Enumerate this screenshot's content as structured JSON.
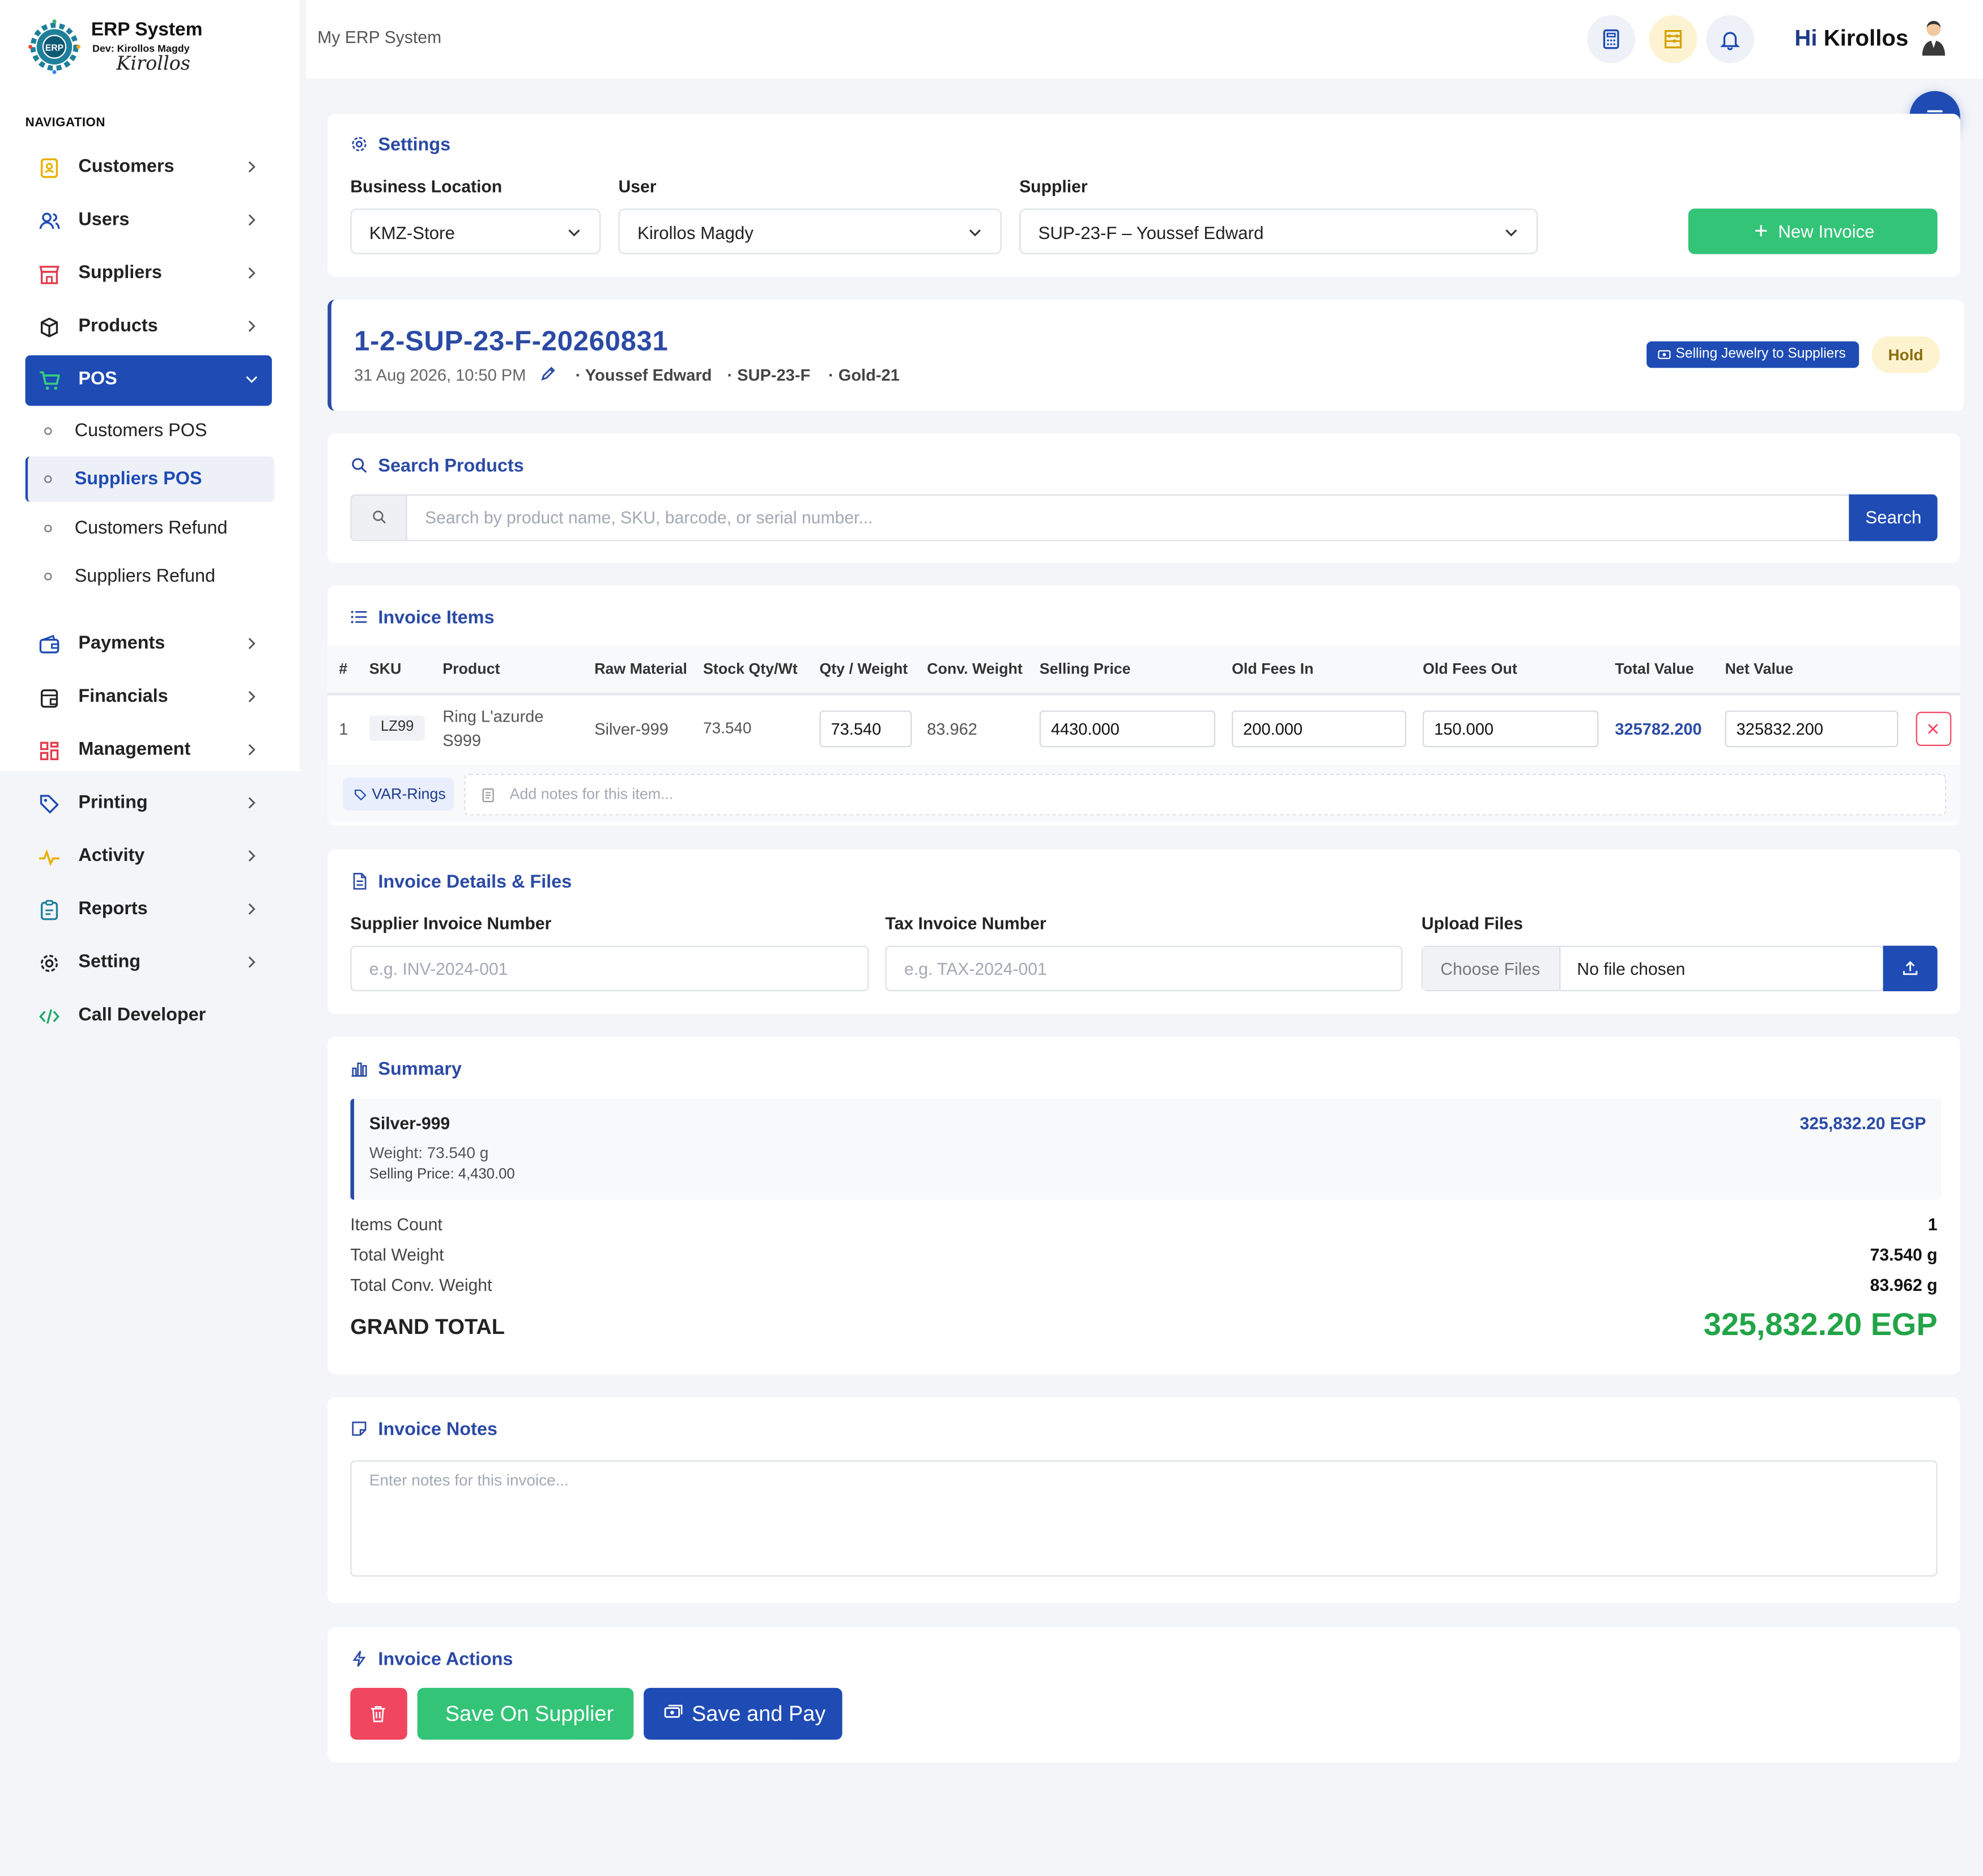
{
  "brand": {
    "title": "ERP System",
    "dev": "Dev: Kirollos Magdy",
    "signature": "Kirollos"
  },
  "nav": {
    "heading": "NAVIGATION",
    "items": [
      {
        "label": "Customers",
        "icon": "address-book-icon"
      },
      {
        "label": "Users",
        "icon": "users-icon"
      },
      {
        "label": "Suppliers",
        "icon": "store-icon"
      },
      {
        "label": "Products",
        "icon": "box-icon"
      },
      {
        "label": "POS",
        "icon": "cart-icon"
      },
      {
        "label": "Payments",
        "icon": "wallet-icon"
      },
      {
        "label": "Financials",
        "icon": "finance-icon"
      },
      {
        "label": "Management",
        "icon": "grid-icon"
      },
      {
        "label": "Printing",
        "icon": "tag-icon"
      },
      {
        "label": "Activity",
        "icon": "activity-icon"
      },
      {
        "label": "Reports",
        "icon": "clipboard-icon"
      },
      {
        "label": "Setting",
        "icon": "gear-icon"
      },
      {
        "label": "Call Developer",
        "icon": "code-icon"
      }
    ],
    "pos_sub": [
      "Customers POS",
      "Suppliers POS",
      "Customers Refund",
      "Suppliers Refund"
    ]
  },
  "topbar": {
    "title": "My ERP System",
    "greeting": "Hi",
    "user": "Kirollos"
  },
  "settings": {
    "title": "Settings",
    "location_label": "Business Location",
    "location_value": "KMZ-Store",
    "user_label": "User",
    "user_value": "Kirollos Magdy",
    "supplier_label": "Supplier",
    "supplier_value": "SUP-23-F – Youssef Edward",
    "new_invoice": "New Invoice"
  },
  "invoice": {
    "number": "1-2-SUP-23-F-20260831",
    "datetime": "31 Aug 2026, 10:50 PM",
    "supplier_name": "· Youssef Edward",
    "supplier_code": "· SUP-23-F",
    "material": "· Gold-21",
    "type_badge": "Selling Jewelry to Suppliers",
    "status": "Hold"
  },
  "search": {
    "title": "Search Products",
    "placeholder": "Search by product name, SKU, barcode, or serial number...",
    "button": "Search"
  },
  "items": {
    "title": "Invoice Items",
    "columns": [
      "#",
      "SKU",
      "Product",
      "Raw Material",
      "Stock Qty/Wt",
      "Qty / Weight",
      "Conv. Weight",
      "Selling Price",
      "Old Fees In",
      "Old Fees Out",
      "Total Value",
      "Net Value"
    ],
    "rows": [
      {
        "index": "1",
        "sku": "LZ99",
        "product_line1": "Ring L'azurde",
        "product_line2": "S999",
        "raw_material": "Silver-999",
        "stock": "73.540",
        "qty": "73.540",
        "conv": "83.962",
        "price": "4430.000",
        "fees_in": "200.000",
        "fees_out": "150.000",
        "total": "325782.200",
        "net": "325832.200",
        "variant": "VAR-Rings",
        "notes_placeholder": "Add notes for this item..."
      }
    ]
  },
  "details": {
    "title": "Invoice Details & Files",
    "supplier_inv_label": "Supplier Invoice Number",
    "supplier_inv_placeholder": "e.g. INV-2024-001",
    "tax_label": "Tax Invoice Number",
    "tax_placeholder": "e.g. TAX-2024-001",
    "upload_label": "Upload Files",
    "choose": "Choose Files",
    "no_file": "No file chosen"
  },
  "summary": {
    "title": "Summary",
    "material": "Silver-999",
    "material_total": "325,832.20 EGP",
    "weight": "Weight: 73.540 g",
    "price": "Selling Price: 4,430.00",
    "items_count_label": "Items Count",
    "items_count": "1",
    "total_weight_label": "Total Weight",
    "total_weight": "73.540 g",
    "total_conv_label": "Total Conv. Weight",
    "total_conv": "83.962 g",
    "grand_label": "GRAND TOTAL",
    "grand_total": "325,832.20 EGP"
  },
  "notes": {
    "title": "Invoice Notes",
    "placeholder": "Enter notes for this invoice..."
  },
  "actions": {
    "title": "Invoice Actions",
    "save_supplier": "Save On Supplier",
    "save_pay": "Save and Pay"
  },
  "colors": {
    "primary": "#1e4bb4",
    "accent_blue": "#2b4aa5",
    "green": "#33c477",
    "grand_green": "#22a447",
    "danger": "#f0465f",
    "hold_bg": "#fdf3cf"
  }
}
